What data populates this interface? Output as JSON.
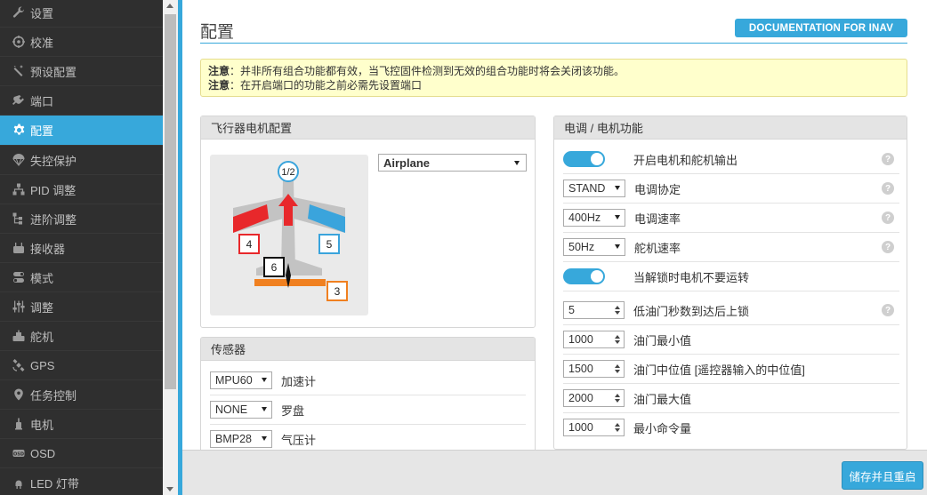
{
  "sidebar": {
    "items": [
      {
        "label": "设置",
        "icon": "wrench-icon"
      },
      {
        "label": "校准",
        "icon": "crosshair-icon"
      },
      {
        "label": "预设配置",
        "icon": "magic-wand-icon"
      },
      {
        "label": "端口",
        "icon": "plug-icon"
      },
      {
        "label": "配置",
        "icon": "gear-icon",
        "active": true
      },
      {
        "label": "失控保护",
        "icon": "parachute-icon"
      },
      {
        "label": "PID 调整",
        "icon": "network-icon"
      },
      {
        "label": "进阶调整",
        "icon": "tree-icon"
      },
      {
        "label": "接收器",
        "icon": "radio-icon"
      },
      {
        "label": "模式",
        "icon": "toggle-icon"
      },
      {
        "label": "调整",
        "icon": "sliders-icon"
      },
      {
        "label": "舵机",
        "icon": "servo-icon"
      },
      {
        "label": "GPS",
        "icon": "satellite-icon"
      },
      {
        "label": "任务控制",
        "icon": "map-pin-icon"
      },
      {
        "label": "电机",
        "icon": "motor-icon"
      },
      {
        "label": "OSD",
        "icon": "osd-icon"
      },
      {
        "label": "LED 灯带",
        "icon": "led-icon"
      }
    ]
  },
  "header": {
    "title": "配置",
    "doc_button": "DOCUMENTATION FOR INAV"
  },
  "notice": {
    "line1_bold": "注意",
    "line1_text": "：并非所有组合功能都有效，当飞控固件检测到无效的组合功能时将会关闭该功能。",
    "line2_bold": "注意",
    "line2_text": "：在开启端口的功能之前必需先设置端口"
  },
  "motor_panel": {
    "title": "飞行器电机配置",
    "airframe": "Airplane",
    "diagram_labels": [
      "1/2",
      "4",
      "5",
      "6",
      "3"
    ]
  },
  "sensors_panel": {
    "title": "传感器",
    "rows": [
      {
        "value": "MPU60",
        "label": "加速计"
      },
      {
        "value": "NONE",
        "label": "罗盘"
      },
      {
        "value": "BMP28",
        "label": "气压计"
      }
    ]
  },
  "esc_panel": {
    "title": "电调 / 电机功能",
    "rows": [
      {
        "kind": "toggle",
        "value": "on",
        "label": "开启电机和舵机输出",
        "help": true
      },
      {
        "kind": "select",
        "value": "STAND",
        "label": "电调协定",
        "help": true
      },
      {
        "kind": "select",
        "value": "400Hz",
        "label": "电调速率",
        "help": true
      },
      {
        "kind": "select",
        "value": "50Hz",
        "label": "舵机速率",
        "help": true
      },
      {
        "kind": "toggle",
        "value": "on",
        "label": "当解锁时电机不要运转",
        "help": false
      },
      {
        "kind": "number",
        "value": "5",
        "label": "低油门秒数到达后上锁",
        "help": true
      },
      {
        "kind": "number",
        "value": "1000",
        "label": "油门最小值",
        "help": false
      },
      {
        "kind": "number",
        "value": "1500",
        "label": "油门中位值 [遥控器输入的中位值]",
        "help": false
      },
      {
        "kind": "number",
        "value": "2000",
        "label": "油门最大值",
        "help": false
      },
      {
        "kind": "number",
        "value": "1000",
        "label": "最小命令量",
        "help": false
      }
    ],
    "help_glyph": "?"
  },
  "footer": {
    "save_button": "储存并且重启"
  },
  "colors": {
    "accent": "#37a8db",
    "sidebar_bg": "#2f2f2f",
    "notice_bg": "#ffffcc",
    "wing_left": "#e8282b",
    "wing_right": "#3aa4dc",
    "tail_bar": "#f08020"
  }
}
